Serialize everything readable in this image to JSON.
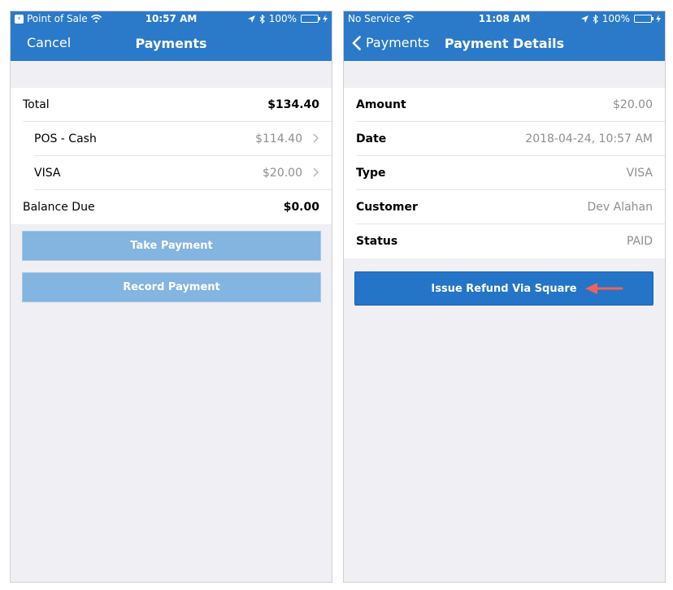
{
  "left": {
    "status": {
      "back_app": "Point of Sale",
      "time": "10:57 AM",
      "battery": "100%"
    },
    "nav": {
      "cancel": "Cancel",
      "title": "Payments"
    },
    "total": {
      "label": "Total",
      "value": "$134.40"
    },
    "payments": [
      {
        "label": "POS - Cash",
        "value": "$114.40"
      },
      {
        "label": "VISA",
        "value": "$20.00"
      }
    ],
    "balance": {
      "label": "Balance Due",
      "value": "$0.00"
    },
    "buttons": {
      "take_payment": "Take Payment",
      "record_payment": "Record Payment"
    }
  },
  "right": {
    "status": {
      "carrier": "No Service",
      "time": "11:08 AM",
      "battery": "100%"
    },
    "nav": {
      "back": "Payments",
      "title": "Payment Details"
    },
    "details": [
      {
        "label": "Amount",
        "value": "$20.00"
      },
      {
        "label": "Date",
        "value": "2018-04-24, 10:57 AM"
      },
      {
        "label": "Type",
        "value": "VISA"
      },
      {
        "label": "Customer",
        "value": "Dev Alahan"
      },
      {
        "label": "Status",
        "value": "PAID"
      }
    ],
    "buttons": {
      "issue_refund": "Issue Refund Via Square"
    }
  },
  "colors": {
    "header": "#2b7ac9",
    "button_primary": "#2474c8",
    "button_disabled": "#84b4e0",
    "annotation_arrow": "#f0625a",
    "battery": "#4cd964"
  }
}
